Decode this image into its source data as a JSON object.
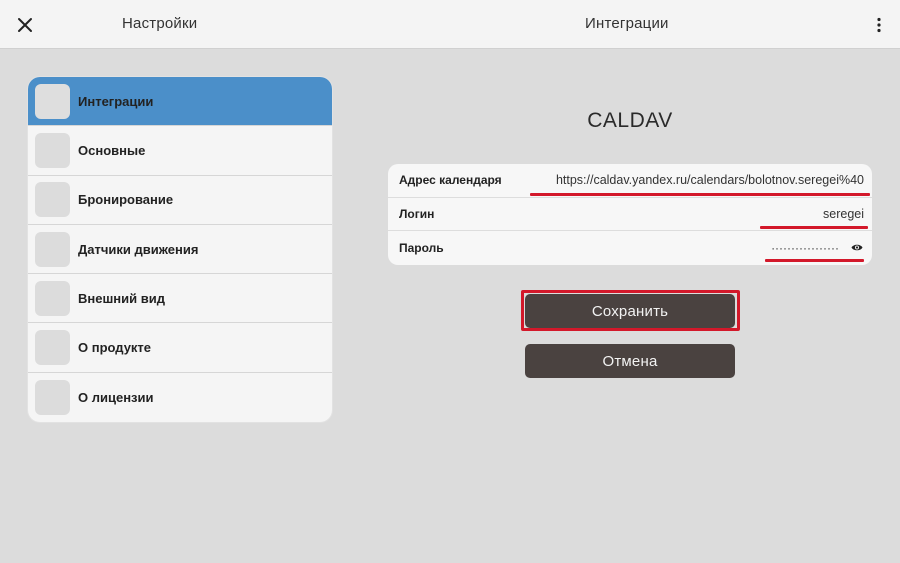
{
  "topbar": {
    "settings_title": "Настройки",
    "page_title": "Интеграции",
    "close_icon": "close-icon",
    "more_icon": "more-vertical-icon"
  },
  "sidebar": {
    "items": [
      {
        "label": "Интеграции",
        "active": true
      },
      {
        "label": "Основные",
        "active": false
      },
      {
        "label": "Бронирование",
        "active": false
      },
      {
        "label": "Датчики движения",
        "active": false
      },
      {
        "label": "Внешний вид",
        "active": false
      },
      {
        "label": "О продукте",
        "active": false
      },
      {
        "label": "О лицензии",
        "active": false
      }
    ]
  },
  "main": {
    "title": "CALDAV",
    "fields": {
      "calendar_url": {
        "label": "Адрес календаря",
        "value": "https://caldav.yandex.ru/calendars/bolotnov.seregei%40"
      },
      "login": {
        "label": "Логин",
        "value": "seregei"
      },
      "password": {
        "label": "Пароль",
        "value": "·················"
      }
    },
    "save_label": "Сохранить",
    "cancel_label": "Отмена"
  },
  "colors": {
    "accent": "#4b8fc9",
    "button": "#4a4240",
    "highlight": "#d3182a",
    "background": "#dcdcdc"
  }
}
